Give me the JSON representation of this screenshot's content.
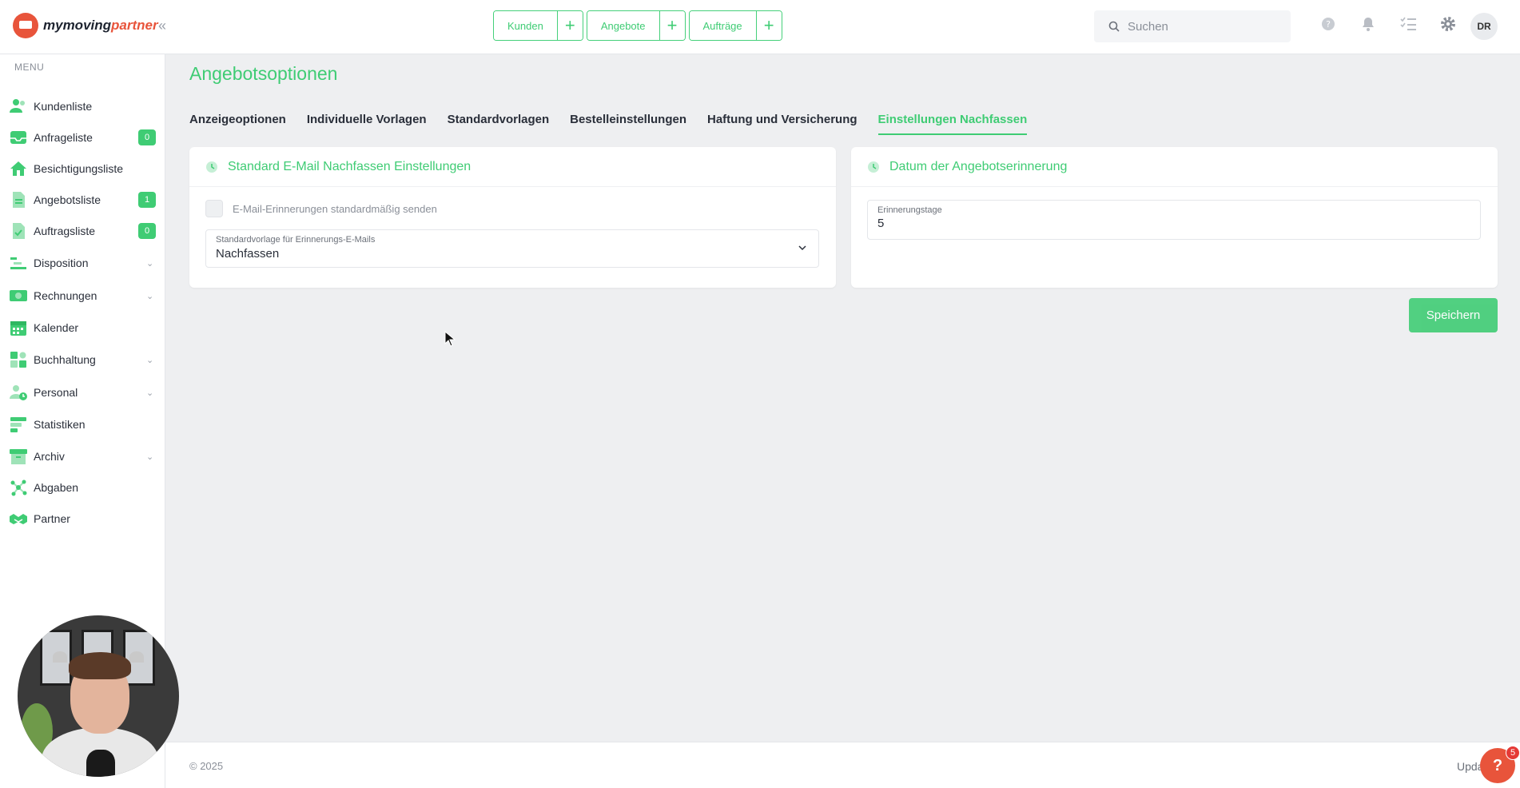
{
  "brand": {
    "name_part1": "mymoving",
    "name_part2": "partner"
  },
  "topbar": {
    "quick_actions": [
      {
        "label": "Kunden"
      },
      {
        "label": "Angebote"
      },
      {
        "label": "Aufträge"
      }
    ],
    "plus_glyph": "+",
    "search_placeholder": "Suchen",
    "user_initials": "DR",
    "icons": [
      "help-circle-icon",
      "bell-icon",
      "checklist-icon",
      "gear-icon"
    ]
  },
  "sidebar": {
    "title": "MENU",
    "items": [
      {
        "label": "Kundenliste",
        "icon": "users-icon"
      },
      {
        "label": "Anfrageliste",
        "icon": "inbox-icon",
        "badge": "0"
      },
      {
        "label": "Besichtigungsliste",
        "icon": "house-icon"
      },
      {
        "label": "Angebotsliste",
        "icon": "document-icon",
        "badge": "1"
      },
      {
        "label": "Auftragsliste",
        "icon": "clipboard-icon",
        "badge": "0"
      },
      {
        "label": "Disposition",
        "icon": "dispatch-icon",
        "expandable": true
      },
      {
        "label": "Rechnungen",
        "icon": "money-icon",
        "expandable": true
      },
      {
        "label": "Kalender",
        "icon": "calendar-icon"
      },
      {
        "label": "Buchhaltung",
        "icon": "grid-icon",
        "expandable": true
      },
      {
        "label": "Personal",
        "icon": "person-clock-icon",
        "expandable": true
      },
      {
        "label": "Statistiken",
        "icon": "stats-icon"
      },
      {
        "label": "Archiv",
        "icon": "archive-icon",
        "expandable": true
      },
      {
        "label": "Abgaben",
        "icon": "network-icon"
      },
      {
        "label": "Partner",
        "icon": "handshake-icon"
      }
    ]
  },
  "main": {
    "title": "Angebotsoptionen",
    "tabs": [
      {
        "label": "Anzeigeoptionen"
      },
      {
        "label": "Individuelle Vorlagen"
      },
      {
        "label": "Standardvorlagen"
      },
      {
        "label": "Bestelleinstellungen"
      },
      {
        "label": "Haftung und Versicherung"
      },
      {
        "label": "Einstellungen Nachfassen",
        "active": true
      }
    ],
    "email_card": {
      "title": "Standard E-Mail Nachfassen Einstellungen",
      "checkbox_label": "E-Mail-Erinnerungen standardmäßig senden",
      "checkbox_checked": false,
      "select_label": "Standardvorlage für Erinnerungs-E-Mails",
      "select_value": "Nachfassen"
    },
    "reminder_card": {
      "title": "Datum der Angebotserinnerung",
      "input_label": "Erinnerungstage",
      "input_value": "5"
    },
    "save_label": "Speichern"
  },
  "footer": {
    "copyright": "© 2025",
    "update_text": "Upda",
    "help_glyph": "?",
    "help_count": "5"
  },
  "colors": {
    "accent": "#3fcc74",
    "brand": "#e8543b",
    "text": "#2a2f3a",
    "muted": "#8a8f98"
  }
}
